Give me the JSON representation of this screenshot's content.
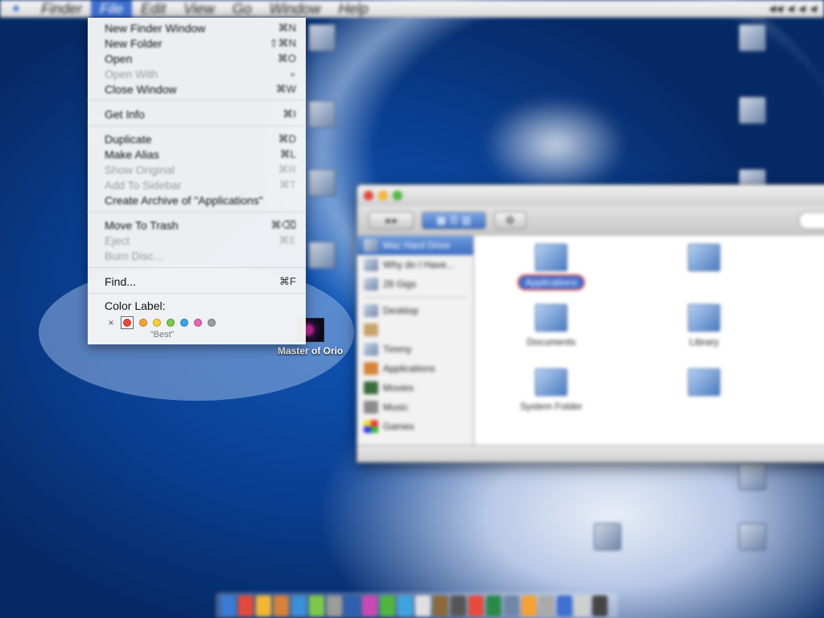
{
  "menubar": {
    "apple": "",
    "items": [
      {
        "label": "Finder"
      },
      {
        "label": "File",
        "active": true
      },
      {
        "label": "Edit"
      },
      {
        "label": "View"
      },
      {
        "label": "Go"
      },
      {
        "label": "Window"
      },
      {
        "label": "Help"
      }
    ]
  },
  "file_menu": {
    "items": [
      {
        "label": "New Finder Window",
        "shortcut": "⌘N",
        "enabled": true
      },
      {
        "label": "New Folder",
        "shortcut": "⇧⌘N",
        "enabled": true
      },
      {
        "label": "Open",
        "shortcut": "⌘O",
        "enabled": true
      },
      {
        "label": "Open With",
        "shortcut": "▸",
        "enabled": false
      },
      {
        "label": "Close Window",
        "shortcut": "⌘W",
        "enabled": true
      },
      {
        "label": "Get Info",
        "shortcut": "⌘I",
        "enabled": true
      },
      {
        "label": "Duplicate",
        "shortcut": "⌘D",
        "enabled": true
      },
      {
        "label": "Make Alias",
        "shortcut": "⌘L",
        "enabled": true
      },
      {
        "label": "Show Original",
        "shortcut": "⌘R",
        "enabled": false
      },
      {
        "label": "Add To Sidebar",
        "shortcut": "⌘T",
        "enabled": false
      },
      {
        "label": "Create Archive of \"Applications\"",
        "shortcut": "",
        "enabled": true
      },
      {
        "label": "Move To Trash",
        "shortcut": "⌘⌫",
        "enabled": true
      },
      {
        "label": "Eject",
        "shortcut": "⌘E",
        "enabled": false
      },
      {
        "label": "Burn Disc...",
        "shortcut": "",
        "enabled": false
      },
      {
        "label": "Find...",
        "shortcut": "⌘F",
        "enabled": true
      }
    ],
    "color_label": {
      "title": "Color Label:",
      "none_glyph": "×",
      "colors": [
        "#e64b3c",
        "#f4a235",
        "#f3d23a",
        "#7cc94a",
        "#3ea3e0",
        "#e266b5",
        "#9b9b9b"
      ],
      "selected_color": "#e64b3c",
      "hover_name": "“Best”"
    }
  },
  "desktop": {
    "icons": [
      {
        "name": "master-of-orion",
        "label": "Master of Orio"
      }
    ]
  },
  "finder_window": {
    "title": "",
    "sidebar": {
      "volumes": [
        {
          "label": "Mac Hard Drive",
          "selected": true
        },
        {
          "label": "Why do I Have...",
          "selected": false
        },
        {
          "label": "28 Gigs",
          "selected": false
        }
      ],
      "places": [
        {
          "label": "Desktop"
        },
        {
          "label": ""
        },
        {
          "label": "Timmy"
        },
        {
          "label": "Applications"
        },
        {
          "label": "Movies"
        },
        {
          "label": "Music"
        },
        {
          "label": "Games"
        }
      ]
    },
    "items": [
      {
        "label": "Applications",
        "highlighted": true
      },
      {
        "label": "",
        "highlighted": false
      },
      {
        "label": "Documents",
        "highlighted": false
      },
      {
        "label": "Library",
        "highlighted": false
      },
      {
        "label": "System Folder",
        "highlighted": false
      },
      {
        "label": "",
        "highlighted": false
      }
    ],
    "status": ""
  },
  "colors": {
    "menu_highlight": "#3f6fd0",
    "selection": "#3c6ec2"
  }
}
